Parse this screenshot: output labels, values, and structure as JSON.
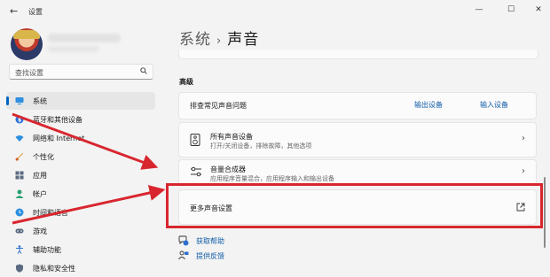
{
  "window": {
    "title": "设置",
    "back_icon": "back-arrow-icon",
    "minimize_glyph": "—",
    "maximize_glyph": "☐",
    "close_glyph": "✕"
  },
  "sidebar": {
    "search_placeholder": "查找设置",
    "items": [
      {
        "label": "系统",
        "icon": "system-icon",
        "active": true
      },
      {
        "label": "蓝牙和其他设备",
        "icon": "bluetooth-icon"
      },
      {
        "label": "网络和 Internet",
        "icon": "network-icon"
      },
      {
        "label": "个性化",
        "icon": "personalization-icon"
      },
      {
        "label": "应用",
        "icon": "apps-icon"
      },
      {
        "label": "帐户",
        "icon": "accounts-icon"
      },
      {
        "label": "时间和语言",
        "icon": "time-language-icon"
      },
      {
        "label": "游戏",
        "icon": "gaming-icon"
      },
      {
        "label": "辅助功能",
        "icon": "accessibility-icon"
      },
      {
        "label": "隐私和安全性",
        "icon": "privacy-icon"
      }
    ]
  },
  "breadcrumb": {
    "parent": "系统",
    "separator": "›",
    "current": "声音"
  },
  "advanced": {
    "heading": "高级",
    "troubleshoot": {
      "title": "排查常见声音问题",
      "output_link": "输出设备",
      "input_link": "输入设备"
    },
    "all_devices": {
      "title": "所有声音设备",
      "subtitle": "打开/关闭设备，排除故障，其他选项"
    },
    "mixer": {
      "title": "音量合成器",
      "subtitle": "应用程序音量混合，应用程序输入和输出设备"
    },
    "more_settings": {
      "title": "更多声音设置"
    }
  },
  "help": {
    "get_help": "获取帮助",
    "feedback": "提供反馈"
  },
  "annotation": {
    "color": "#d8262f"
  }
}
